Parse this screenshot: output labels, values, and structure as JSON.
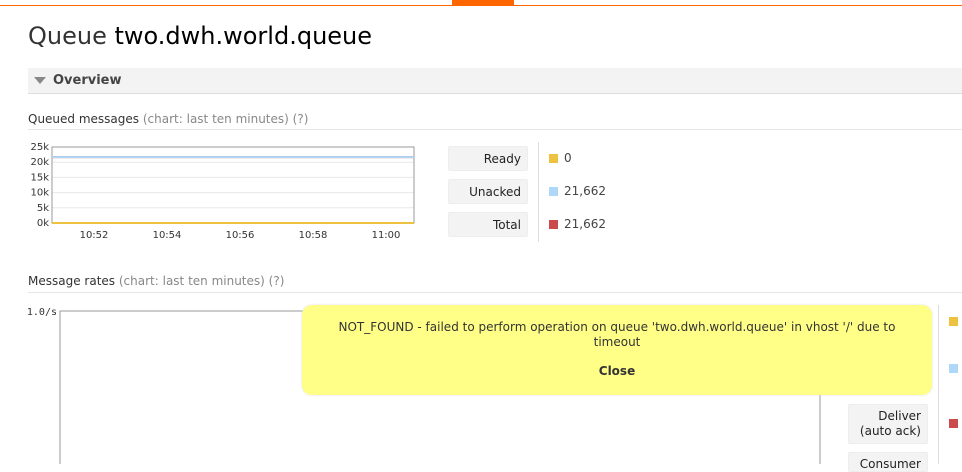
{
  "page": {
    "title_prefix": "Queue",
    "queue_name": "two.dwh.world.queue"
  },
  "overview": {
    "label": "Overview"
  },
  "queued_messages": {
    "title": "Queued messages",
    "chart_note": "(chart: last ten minutes)",
    "help": "(?)",
    "legend": [
      {
        "label": "Ready",
        "value": "0",
        "color": "#edc240"
      },
      {
        "label": "Unacked",
        "value": "21,662",
        "color": "#afd8f8"
      },
      {
        "label": "Total",
        "value": "21,662",
        "color": "#cb4b4b"
      }
    ]
  },
  "message_rates": {
    "title": "Message rates",
    "chart_note": "(chart: last ten minutes)",
    "help": "(?)",
    "legend": [
      {
        "label": "Deliver\n(auto ack)",
        "color": "#cb4b4b"
      },
      {
        "label": "Consumer"
      }
    ],
    "swatch_colors": [
      "#edc240",
      "#afd8f8",
      "#cb4b4b"
    ]
  },
  "notice": {
    "message": "NOT_FOUND - failed to perform operation on queue 'two.dwh.world.queue' in vhost '/' due to timeout",
    "close_label": "Close"
  },
  "chart_data": [
    {
      "type": "line",
      "title": "",
      "x": [
        "10:52",
        "10:54",
        "10:56",
        "10:58",
        "11:00"
      ],
      "yticks": [
        "25k",
        "20k",
        "15k",
        "10k",
        "5k",
        "0k"
      ],
      "ylim": [
        0,
        25000
      ],
      "series": [
        {
          "name": "Total",
          "color": "#cb4b4b",
          "values": [
            21662,
            21662,
            21662,
            21662,
            21662
          ]
        },
        {
          "name": "Unacked",
          "color": "#afd8f8",
          "values": [
            21662,
            21662,
            21662,
            21662,
            21662
          ]
        },
        {
          "name": "Ready",
          "color": "#edc240",
          "values": [
            0,
            0,
            0,
            0,
            0
          ]
        }
      ],
      "grid": true
    },
    {
      "type": "line",
      "title": "",
      "yticks": [
        "1.0/s"
      ],
      "series": []
    }
  ]
}
